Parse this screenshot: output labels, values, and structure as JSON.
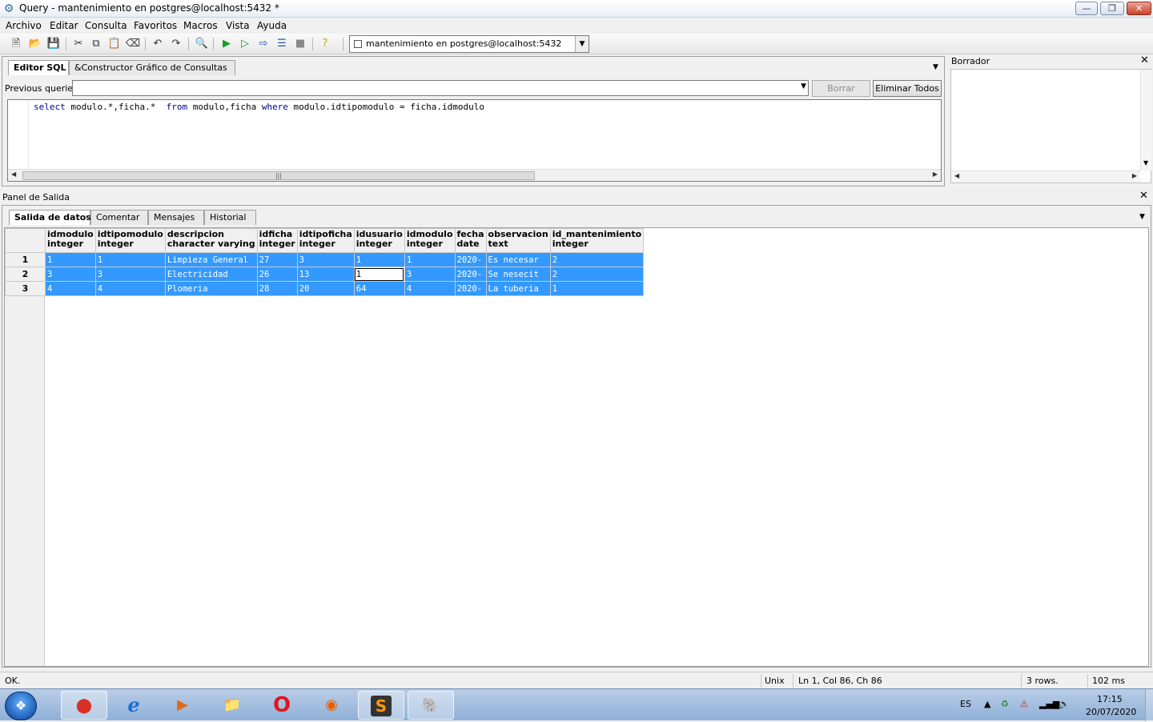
{
  "window": {
    "title": "Query - mantenimiento en postgres@localhost:5432 *",
    "min": "—",
    "max": "❐",
    "close": "✕"
  },
  "menu": [
    "Archivo",
    "Editar",
    "Consulta",
    "Favoritos",
    "Macros",
    "Vista",
    "Ayuda"
  ],
  "connection": {
    "label": "mantenimiento en postgres@localhost:5432"
  },
  "editor": {
    "tabs": [
      "Editor SQL",
      "&Constructor Gráfico de Consultas"
    ],
    "previous_label": "Previous queries",
    "previous_value": "",
    "borrar": "Borrar",
    "eliminar_todos": "Eliminar Todos",
    "sql": {
      "p1": "select",
      "p2": " modulo.*,ficha.*  ",
      "p3": "from",
      "p4": " modulo,ficha ",
      "p5": "where",
      "p6": " modulo.idtipomodulo = ficha.idmodulo"
    }
  },
  "borrador": {
    "title": "Borrador",
    "content": ""
  },
  "output": {
    "title": "Panel de Salida",
    "tabs": [
      "Salida de datos",
      "Comentar",
      "Mensajes",
      "Historial"
    ],
    "columns": [
      {
        "name": "idmodulo",
        "type": "integer"
      },
      {
        "name": "idtipomodulo",
        "type": "integer"
      },
      {
        "name": "descripcion",
        "type": "character varying"
      },
      {
        "name": "idficha",
        "type": "integer"
      },
      {
        "name": "idtipoficha",
        "type": "integer"
      },
      {
        "name": "idusuario",
        "type": "integer"
      },
      {
        "name": "idmodulo",
        "type": "integer"
      },
      {
        "name": "fecha",
        "type": "date"
      },
      {
        "name": "observacion",
        "type": "text"
      },
      {
        "name": "id_mantenimiento",
        "type": "integer"
      }
    ],
    "rows": [
      {
        "n": "1",
        "cells": [
          "1",
          "1",
          "Limpieza General",
          "27",
          "3",
          "1",
          "1",
          "2020-",
          "Es necesar",
          "2"
        ]
      },
      {
        "n": "2",
        "cells": [
          "3",
          "3",
          "Electricidad",
          "26",
          "13",
          "1",
          "3",
          "2020-",
          "Se nesecit",
          "2"
        ]
      },
      {
        "n": "3",
        "cells": [
          "4",
          "4",
          "Plomeria",
          "28",
          "20",
          "64",
          "4",
          "2020-",
          "La tuberia",
          "1"
        ]
      }
    ]
  },
  "status": {
    "message": "OK.",
    "line_ending": "Unix",
    "position": "Ln 1, Col 86, Ch 86",
    "rows": "3 rows.",
    "time": "102 ms"
  },
  "taskbar": {
    "lang": "ES",
    "time": "17:15",
    "date": "20/07/2020"
  }
}
